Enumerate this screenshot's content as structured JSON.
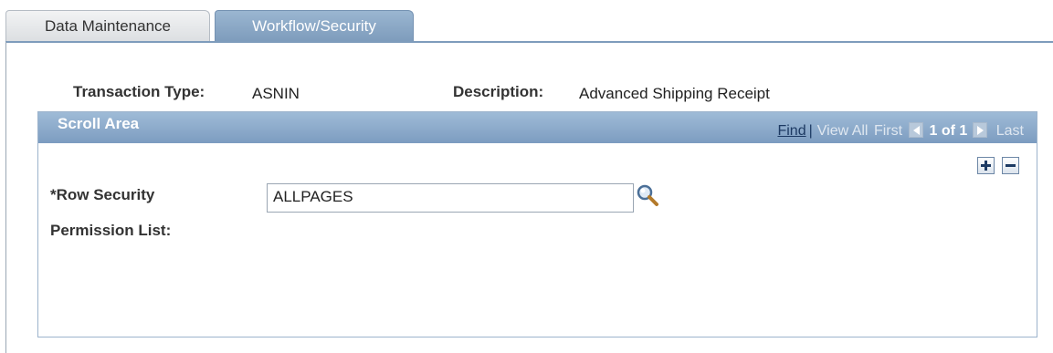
{
  "tabs": [
    {
      "label": "Data Maintenance",
      "active": false
    },
    {
      "label": "Workflow/Security",
      "active": true
    }
  ],
  "header": {
    "transaction_type_label": "Transaction Type:",
    "transaction_type_value": "ASNIN",
    "description_label": "Description:",
    "description_value": "Advanced Shipping Receipt"
  },
  "scroll_area": {
    "title": "Scroll Area",
    "nav": {
      "find": "Find",
      "separator": "|",
      "view_all": "View All",
      "first": "First",
      "count": "1 of 1",
      "last": "Last"
    },
    "row_security_label": "*Row Security",
    "permission_list_label": "Permission List:",
    "row_security_value": "ALLPAGES"
  },
  "icons": [
    "first-arrow-icon",
    "next-arrow-icon",
    "add-row-icon",
    "delete-row-icon",
    "lookup-magnifier-icon"
  ],
  "colors": {
    "accent": "#7e9cbc",
    "header_gradient_top": "#9fbbd7",
    "link": "#1d3a63"
  }
}
